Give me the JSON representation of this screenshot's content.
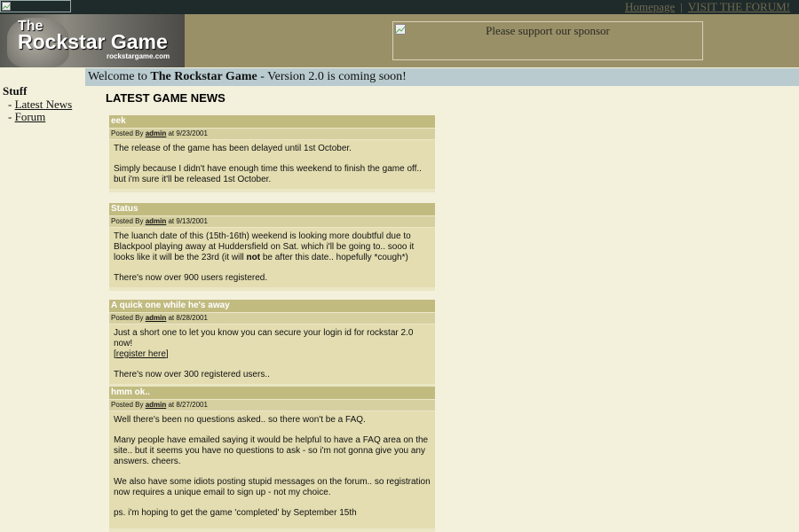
{
  "topbar": {
    "links": [
      "Homepage",
      "VISIT THE FORUM!"
    ]
  },
  "header": {
    "logo_line1": "The",
    "logo_line2": "Rockstar Game",
    "logo_url_text": "rockstargame.com",
    "sponsor_text": "Please support our sponsor"
  },
  "welcome": {
    "prefix": "Welcome to ",
    "site_name": "The Rockstar Game",
    "suffix": " - Version 2.0 is coming soon!"
  },
  "nav": {
    "heading": "Stuff",
    "items": [
      "Latest News",
      "Forum"
    ]
  },
  "main": {
    "title": "LATEST GAME NEWS"
  },
  "posts": [
    {
      "title": "eek",
      "posted_by": "Posted By ",
      "author": "admin",
      "date": " at 9/23/2001",
      "p1": "The release of the game has been delayed until 1st October.",
      "p2": "Simply because I didn't have enough time this weekend to finish the game off.. but i'm sure it'll be released 1st October."
    },
    {
      "title": "Status",
      "posted_by": "Posted By ",
      "author": "admin",
      "date": " at 9/13/2001",
      "p1a": "The luanch date of this (15th-16th) weekend is looking more doubtful due to Blackpool playing away at Huddersfield on Sat. which i'll be going to.. sooo it looks like it will be the 23rd (it will ",
      "p1b": "not",
      "p1c": " be after this date.. hopefully *cough*)",
      "p2": "There's now over 900 users registered."
    },
    {
      "title": "A quick one while he's away",
      "posted_by": "Posted By ",
      "author": "admin",
      "date": " at 8/28/2001",
      "p1": "Just a short one to let you know you can secure your login id for rockstar 2.0 now!",
      "link": "register here",
      "p2": "There's now over 300 registered users.."
    },
    {
      "title": "hmm ok..",
      "posted_by": "Posted By ",
      "author": "admin",
      "date": " at 8/27/2001",
      "p1": "Well there's been no questions asked.. so there won't be a FAQ.",
      "p2": "Many people have emailed saying it would be helpful to have a FAQ area on the site.. but it seems you have no questions to ask - so i'm not gonna give you any answers. cheers.",
      "p3": "We also have some idiots posting stupid messages on the forum.. so registration now requires a unique email to sign up - not my choice.",
      "p4": "ps. i'm hoping to get the game 'completed' by September 15th"
    }
  ]
}
